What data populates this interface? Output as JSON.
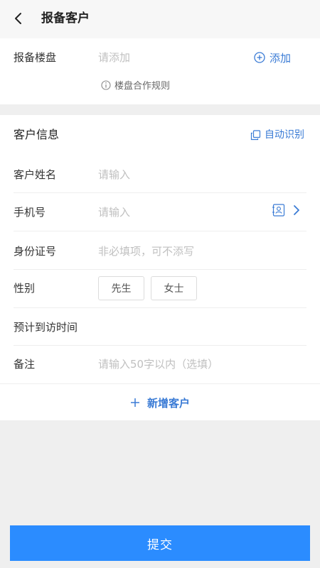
{
  "header": {
    "title": "报备客户",
    "back_icon": "chevron-left-icon"
  },
  "project": {
    "label": "报备楼盘",
    "placeholder": "请添加",
    "add_label": "添加",
    "rule_label": "楼盘合作规则"
  },
  "customer": {
    "section_title": "客户信息",
    "auto_recognize_label": "自动识别",
    "name_label": "客户姓名",
    "name_placeholder": "请输入",
    "phone_label": "手机号",
    "phone_placeholder": "请输入",
    "id_label": "身份证号",
    "id_placeholder": "非必填项，可不添写",
    "gender_label": "性别",
    "gender_options": [
      "先生",
      "女士"
    ],
    "visit_time_label": "预计到访时间",
    "remark_label": "备注",
    "remark_placeholder": "请输入50字以内（选填）",
    "add_customer_label": "新增客户"
  },
  "footer": {
    "submit_label": "提交"
  },
  "colors": {
    "accent": "#3a7bd5",
    "submit_bg": "#2b8cff",
    "page_bg": "#efefef"
  }
}
